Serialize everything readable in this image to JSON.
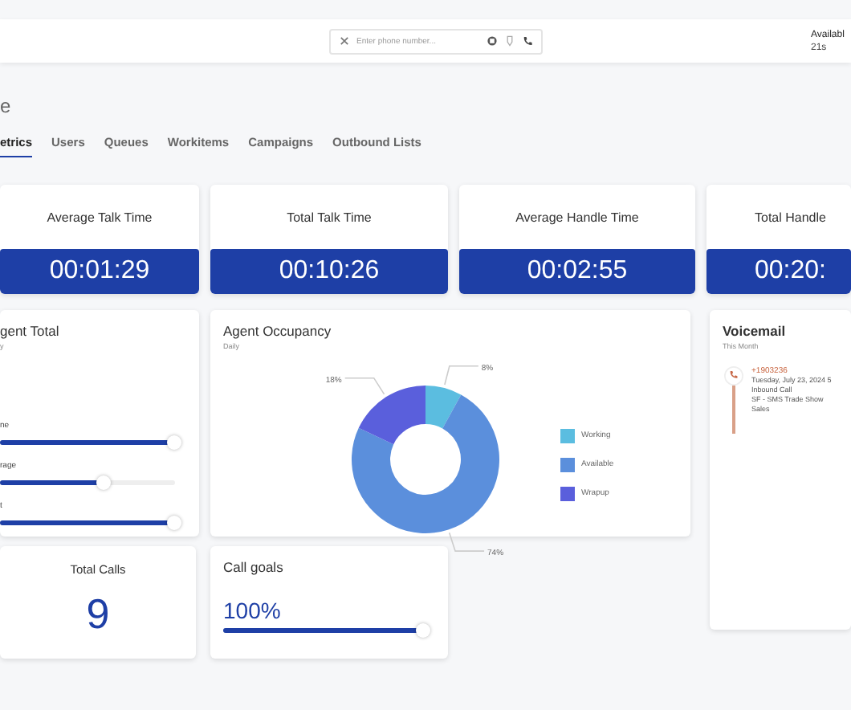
{
  "header": {
    "phone_field": {
      "placeholder": "Enter phone number..."
    },
    "agent_status": {
      "label": "Availabl",
      "timer": "21s"
    }
  },
  "page_title": "e",
  "tabs": [
    {
      "label": "etrics",
      "selected": true
    },
    {
      "label": "Users",
      "selected": false
    },
    {
      "label": "Queues",
      "selected": false
    },
    {
      "label": "Workitems",
      "selected": false
    },
    {
      "label": "Campaigns",
      "selected": false
    },
    {
      "label": "Outbound Lists",
      "selected": false
    }
  ],
  "stat_cards": [
    {
      "title": "Average Talk Time",
      "value": "00:01:29"
    },
    {
      "title": "Total Talk Time",
      "value": "00:10:26"
    },
    {
      "title": "Average Handle Time",
      "value": "00:02:55"
    },
    {
      "title": "Total Handle",
      "value": "00:20:"
    }
  ],
  "agent_total": {
    "title": "gent Total",
    "subtitle": "y",
    "sliders": [
      {
        "label": "ne",
        "level": 1
      },
      {
        "label": "rage",
        "level": 0.6
      },
      {
        "label": "t",
        "level": 1
      }
    ]
  },
  "occupancy": {
    "title": "Agent Occupancy",
    "subtitle": "Daily",
    "chart_data": {
      "type": "donut",
      "categories": [
        "Working",
        "Available",
        "Wrapup"
      ],
      "values": [
        8,
        74,
        18
      ],
      "value_labels": [
        "8%",
        "74%",
        "18%"
      ]
    },
    "legend": [
      {
        "color": "#5bbde0"
      },
      {
        "color": "#5b8fdc"
      },
      {
        "color": "#5a5fdc"
      }
    ]
  },
  "voicemail": {
    "title": "Voicemail",
    "subtitle": "This Month",
    "entries": [
      {
        "number": "+1903236",
        "lines": [
          "Tuesday, July 23, 2024 5",
          "Inbound Call",
          "SF - SMS Trade Show",
          "Sales"
        ]
      }
    ]
  },
  "total_calls": {
    "title": "Total Calls",
    "value": "9"
  },
  "call_goals": {
    "title": "Call goals",
    "value": "100%",
    "level": 1
  }
}
